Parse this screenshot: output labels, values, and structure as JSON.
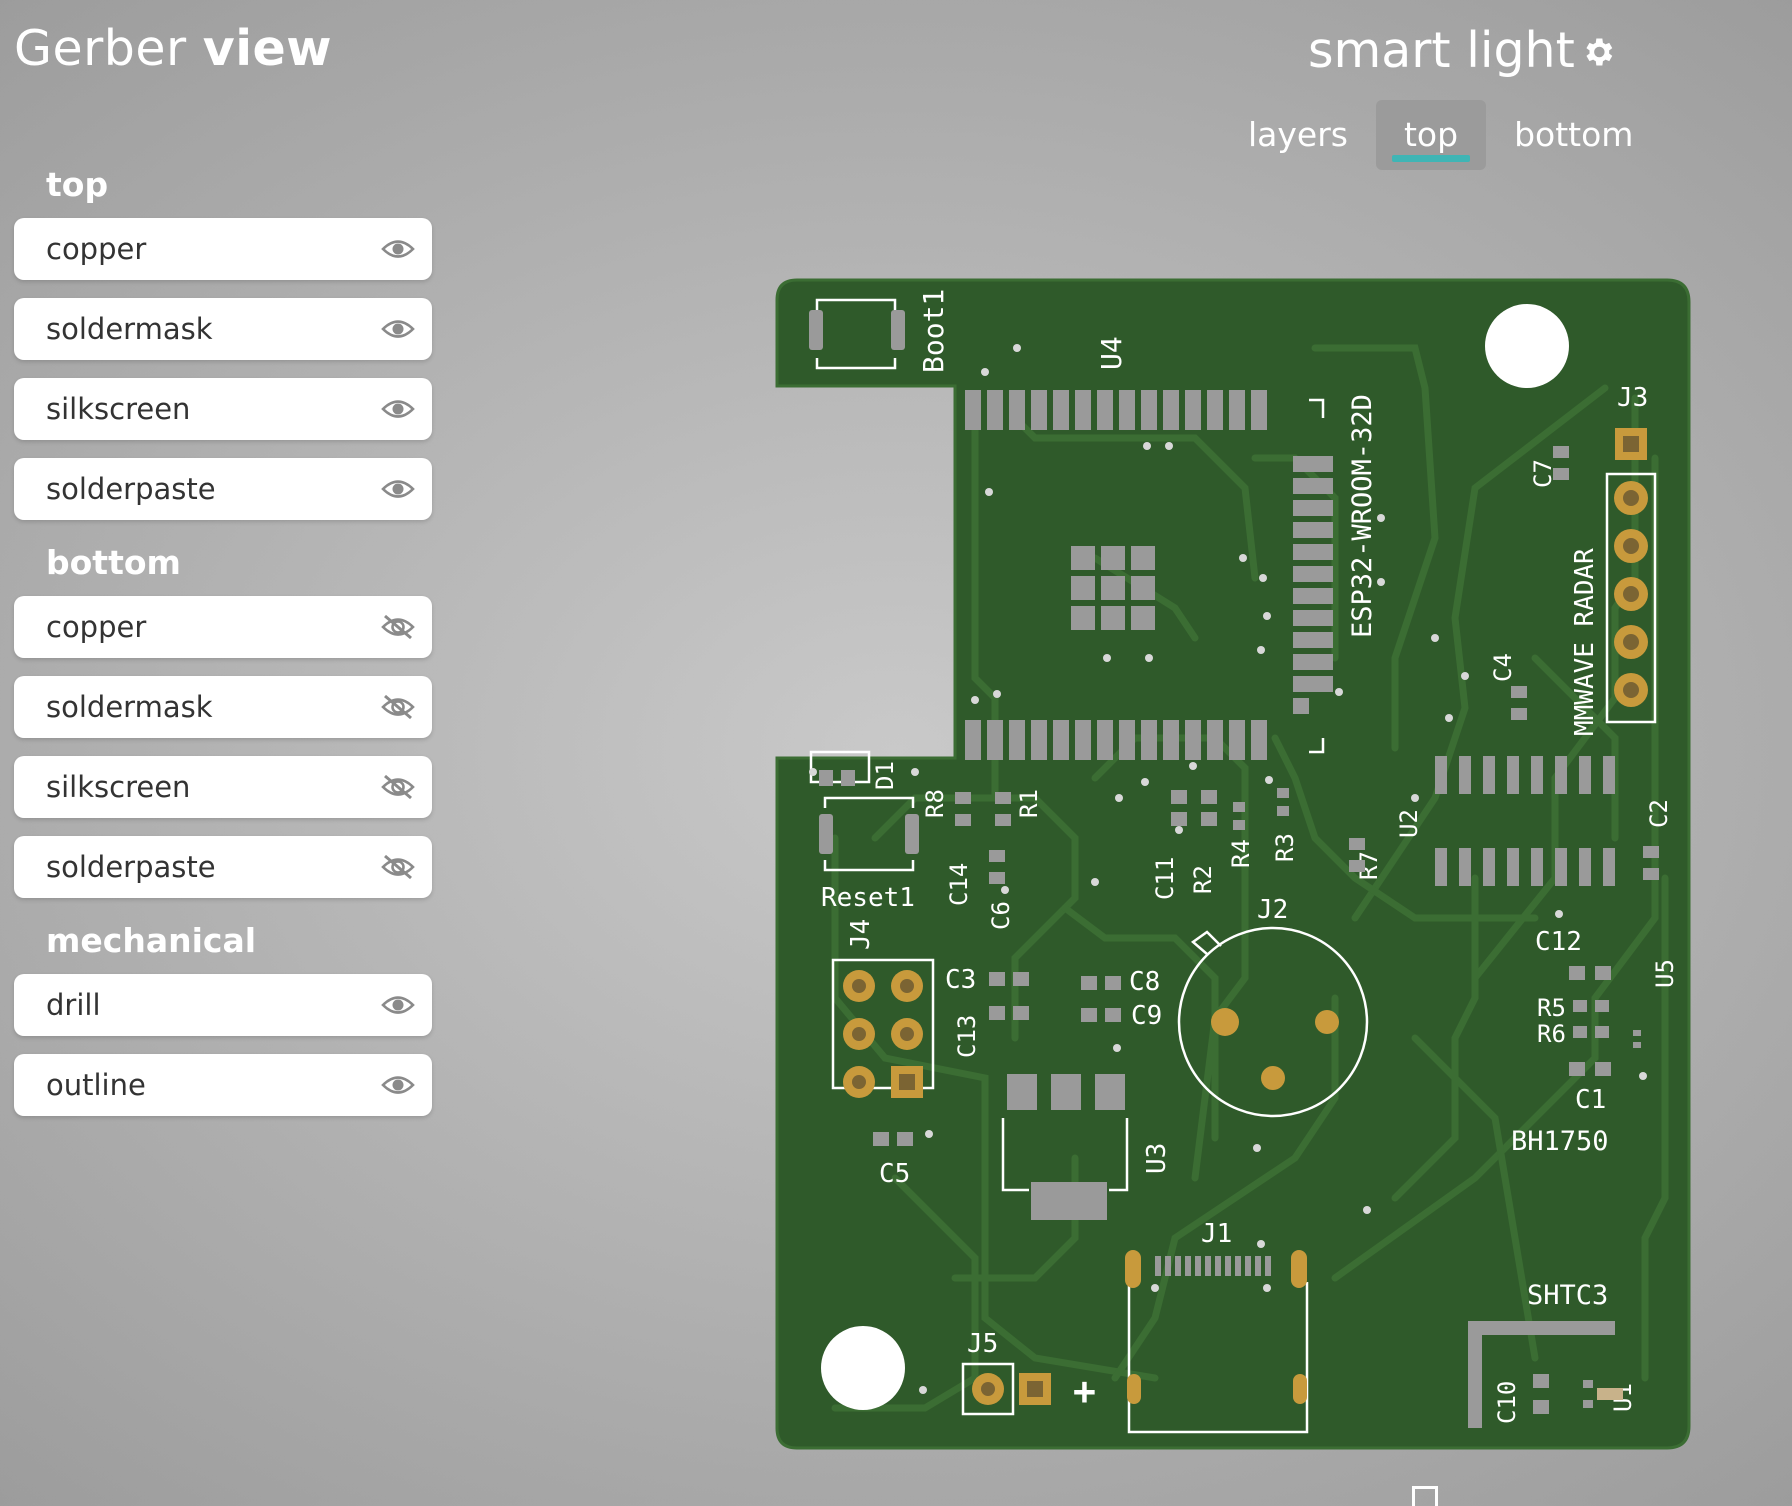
{
  "app": {
    "title_regular": "Gerber",
    "title_bold": "view"
  },
  "project": {
    "name": "smart light"
  },
  "tabs": [
    {
      "label": "layers"
    },
    {
      "label": "top",
      "active": true
    },
    {
      "label": "bottom"
    }
  ],
  "sidebar": {
    "groups": [
      {
        "title": "top",
        "layers": [
          {
            "label": "copper",
            "visible": true
          },
          {
            "label": "soldermask",
            "visible": true
          },
          {
            "label": "silkscreen",
            "visible": true
          },
          {
            "label": "solderpaste",
            "visible": true
          }
        ]
      },
      {
        "title": "bottom",
        "layers": [
          {
            "label": "copper",
            "visible": false
          },
          {
            "label": "soldermask",
            "visible": false
          },
          {
            "label": "silkscreen",
            "visible": false
          },
          {
            "label": "solderpaste",
            "visible": false
          }
        ]
      },
      {
        "title": "mechanical",
        "layers": [
          {
            "label": "drill",
            "visible": true
          },
          {
            "label": "outline",
            "visible": true
          }
        ]
      }
    ]
  },
  "pcb": {
    "colors": {
      "board": "#2f5a2a",
      "trace": "#3b6d33",
      "copper": "#c89a3c",
      "pad": "#9a9a9a",
      "silk": "#ffffff"
    },
    "labels": {
      "boot": "Boot1",
      "u4": "U4",
      "esp": "ESP32-WROOM-32D",
      "j3": "J3",
      "c7": "C7",
      "radar": "MMWAVE RADAR",
      "c4": "C4",
      "d1": "D1",
      "r8": "R8",
      "r1": "R1",
      "c14": "C14",
      "c6": "C6",
      "reset": "Reset1",
      "c11": "C11",
      "r2": "R2",
      "r4": "R4",
      "r3": "R3",
      "r7": "R7",
      "u2": "U2",
      "c2": "C2",
      "j2": "J2",
      "j4": "J4",
      "c3": "C3",
      "c13": "C13",
      "c8": "C8",
      "c9": "C9",
      "c12": "C12",
      "u5": "U5",
      "r5": "R5",
      "r6": "R6",
      "c1": "C1",
      "bh": "BH1750",
      "u3": "U3",
      "c5": "C5",
      "j1": "J1",
      "j5": "J5",
      "plus": "+",
      "shtc3": "SHTC3",
      "c10": "C10",
      "u1": "U1"
    }
  },
  "icons": {
    "eye": "eye-icon",
    "eye_off": "eye-off-icon",
    "settings": "gear-icon"
  }
}
